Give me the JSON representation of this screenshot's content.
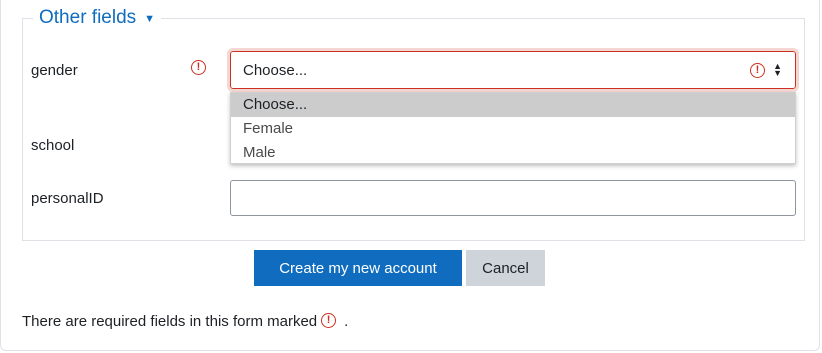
{
  "form": {
    "section_title": "Other fields",
    "fields": [
      {
        "label": "gender"
      },
      {
        "label": "school"
      },
      {
        "label": "personalID",
        "value": ""
      }
    ],
    "gender_select": {
      "selected": "Choose...",
      "options": [
        "Choose...",
        "Female",
        "Male"
      ]
    },
    "required_icon_glyph": "!",
    "buttons": {
      "submit": "Create my new account",
      "cancel": "Cancel"
    },
    "required_note": "There are required fields in this form marked",
    "required_note_end": "."
  },
  "colors": {
    "brand": "#0f6cbf",
    "required": "#ca3120",
    "secondary_button": "#ced4da"
  }
}
